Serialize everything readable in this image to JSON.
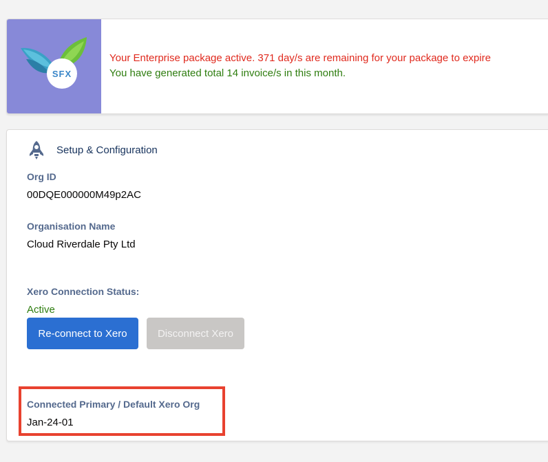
{
  "banner": {
    "logo_text": "SFX",
    "expiry_message": "Your Enterprise package active. 371 day/s are remaining for your package to expire",
    "invoice_message": "You have generated total 14 invoice/s in this month."
  },
  "setup": {
    "icon": "rocket-icon",
    "title": "Setup & Configuration",
    "org_id_label": "Org ID",
    "org_id_value": "00DQE000000M49p2AC",
    "org_name_label": "Organisation Name",
    "org_name_value": "Cloud Riverdale Pty Ltd",
    "connection_status_label": "Xero Connection Status:",
    "connection_status_value": "Active",
    "reconnect_button": "Re-connect to Xero",
    "disconnect_button": "Disconnect Xero",
    "default_org_label": "Connected Primary / Default Xero Org",
    "default_org_value": "Jan-24-01"
  },
  "colors": {
    "logo_bg": "#8789d8",
    "expiry_text": "#e0291d",
    "invoice_text": "#2e7d0f",
    "status_active": "#2e7d0f",
    "primary_button": "#2b6fd2",
    "disabled_button": "#c9c7c5",
    "highlight_border": "#e8422f"
  }
}
